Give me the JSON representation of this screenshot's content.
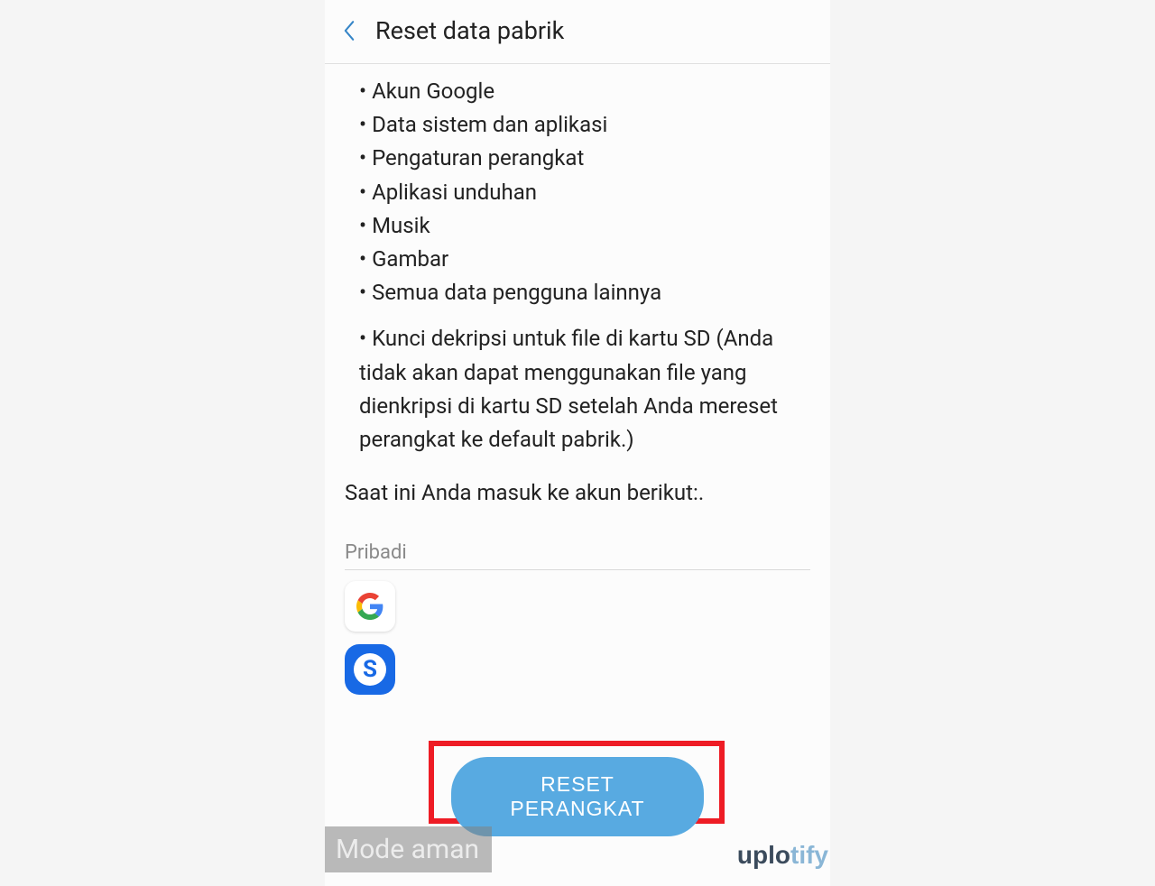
{
  "header": {
    "title": "Reset data pabrik"
  },
  "bullets": {
    "item1": "Akun Google",
    "item2": "Data sistem dan aplikasi",
    "item3": "Pengaturan perangkat",
    "item4": "Aplikasi unduhan",
    "item5": "Musik",
    "item6": "Gambar",
    "item7": "Semua data pengguna lainnya",
    "item8": "Kunci dekripsi untuk file di kartu SD (Anda tidak akan dapat menggunakan file yang dienkripsi di kartu SD setelah Anda mereset perangkat ke default pabrik.)"
  },
  "accountInfo": "Saat ini Anda masuk ke akun berikut:.",
  "sectionLabel": "Pribadi",
  "resetButton": "RESET PERANGKAT",
  "safeMode": "Mode aman",
  "watermark": {
    "uplo": "uplo",
    "tify": "tify"
  }
}
